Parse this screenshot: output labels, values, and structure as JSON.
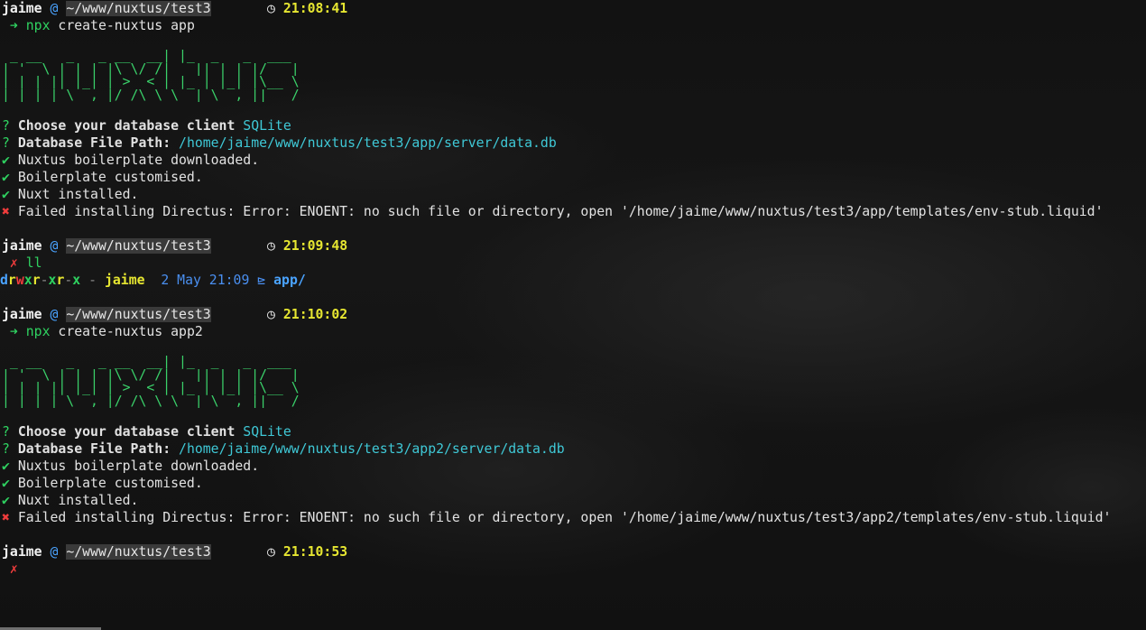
{
  "prompt": {
    "user": "jaime",
    "at": "@",
    "path": "~/www/nuxtus/test3",
    "clock_icon": "clock-icon",
    "arrow": "➜",
    "fail": "✗"
  },
  "ascii_logo": [
    "                          _",
    " _ __   _   _ __  __| |_  _   _  ___",
    "| '_ \\ | | | |\\ \\/ /| __|| | | |/ __|",
    "| | | || |_| | >  < | |_ | |_| |\\__ \\",
    "|_| |_| \\__,_|/_/\\_\\ \\__| \\__,_||___/"
  ],
  "blocks": [
    {
      "time": "21:08:41",
      "cmd_prefix": "npx",
      "cmd_rest": " create-nuxtus app",
      "db_q": "Choose your database client",
      "db_a": "SQLite",
      "path_q": "Database File Path:",
      "path_a": "/home/jaime/www/nuxtus/test3/app/server/data.db",
      "ok1": "Nuxtus boilerplate downloaded.",
      "ok2": "Boilerplate customised.",
      "ok3": "Nuxt installed.",
      "err": "Failed installing Directus: Error: ENOENT: no such file or directory, open '/home/jaime/www/nuxtus/test3/app/templates/env-stub.liquid'"
    },
    {
      "time": "21:10:02",
      "cmd_prefix": "npx",
      "cmd_rest": " create-nuxtus app2",
      "db_q": "Choose your database client",
      "db_a": "SQLite",
      "path_q": "Database File Path:",
      "path_a": "/home/jaime/www/nuxtus/test3/app2/server/data.db",
      "ok1": "Nuxtus boilerplate downloaded.",
      "ok2": "Boilerplate customised.",
      "ok3": "Nuxt installed.",
      "err": "Failed installing Directus: Error: ENOENT: no such file or directory, open '/home/jaime/www/nuxtus/test3/app2/templates/env-stub.liquid'"
    }
  ],
  "ll_block": {
    "time": "21:09:48",
    "cmd": "ll",
    "entry": {
      "perm_d": "d",
      "perm_r1": "r",
      "perm_w": "w",
      "perm_x1": "x",
      "perm_r2": "r",
      "perm_dash1": "-",
      "perm_x2": "x",
      "perm_r3": "r",
      "perm_dash2": "-",
      "perm_x3": "x",
      "size": "-",
      "owner": "jaime",
      "date": "2 May 21:09",
      "folder_icon": "folder-icon",
      "name": "app/"
    }
  },
  "last_prompt": {
    "time": "21:10:53"
  },
  "symbols": {
    "question": "?",
    "check": "✔",
    "cross": "✖"
  },
  "colors": {
    "background": "#0d0d0e",
    "green": "#2fd160",
    "red": "#f03c3c",
    "cyan": "#3fc8d6",
    "yellow": "#e6e631",
    "blue": "#4aa3ff"
  }
}
